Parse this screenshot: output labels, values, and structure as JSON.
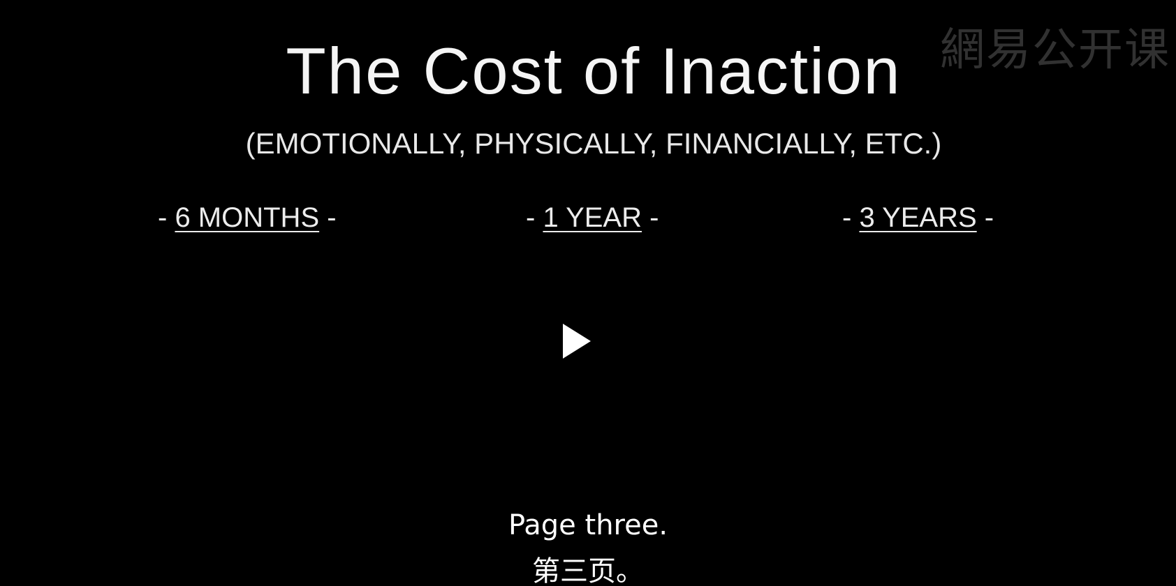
{
  "watermark": {
    "text": "網易公开课"
  },
  "slide": {
    "title": "The Cost of Inaction",
    "subtitle": "(EMOTIONALLY, PHYSICALLY, FINANCIALLY, ETC.)",
    "periods": [
      {
        "prefix": "- ",
        "label": "6 MONTHS",
        "suffix": " -"
      },
      {
        "prefix": "- ",
        "label": "1 YEAR",
        "suffix": " -"
      },
      {
        "prefix": "- ",
        "label": "3 YEARS",
        "suffix": " -"
      }
    ]
  },
  "player": {
    "play_icon": "play-icon"
  },
  "captions": {
    "english": "Page three.",
    "chinese": "第三页。"
  },
  "colors": {
    "background": "#000000",
    "text": "#f2f2f2",
    "watermark": "#3a3a3a"
  }
}
